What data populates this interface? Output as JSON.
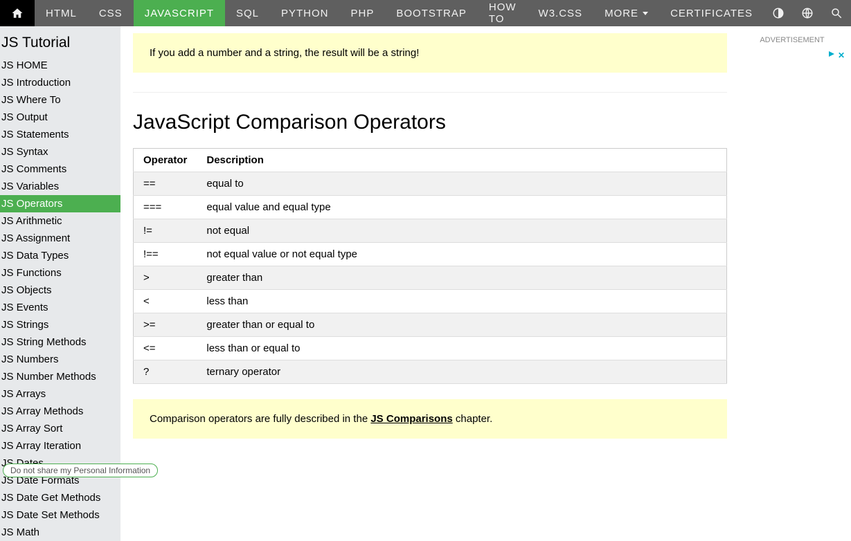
{
  "topnav": {
    "items": [
      {
        "label": "HTML"
      },
      {
        "label": "CSS"
      },
      {
        "label": "JAVASCRIPT",
        "active": true
      },
      {
        "label": "SQL"
      },
      {
        "label": "PYTHON"
      },
      {
        "label": "PHP"
      },
      {
        "label": "BOOTSTRAP"
      },
      {
        "label": "HOW TO"
      },
      {
        "label": "W3.CSS"
      }
    ],
    "more_label": "MORE",
    "certificates_label": "CERTIFICATES"
  },
  "sidebar": {
    "heading": "JS Tutorial",
    "items": [
      {
        "label": "JS HOME"
      },
      {
        "label": "JS Introduction"
      },
      {
        "label": "JS Where To"
      },
      {
        "label": "JS Output"
      },
      {
        "label": "JS Statements"
      },
      {
        "label": "JS Syntax"
      },
      {
        "label": "JS Comments"
      },
      {
        "label": "JS Variables"
      },
      {
        "label": "JS Operators",
        "active": true
      },
      {
        "label": "JS Arithmetic"
      },
      {
        "label": "JS Assignment"
      },
      {
        "label": "JS Data Types"
      },
      {
        "label": "JS Functions"
      },
      {
        "label": "JS Objects"
      },
      {
        "label": "JS Events"
      },
      {
        "label": "JS Strings"
      },
      {
        "label": "JS String Methods"
      },
      {
        "label": "JS Numbers"
      },
      {
        "label": "JS Number Methods"
      },
      {
        "label": "JS Arrays"
      },
      {
        "label": "JS Array Methods"
      },
      {
        "label": "JS Array Sort"
      },
      {
        "label": "JS Array Iteration"
      },
      {
        "label": "JS Dates"
      },
      {
        "label": "JS Date Formats"
      },
      {
        "label": "JS Date Get Methods"
      },
      {
        "label": "JS Date Set Methods"
      },
      {
        "label": "JS Math"
      }
    ]
  },
  "notes": {
    "top": "If you add a number and a string, the result will be a string!",
    "bottom_pre": "Comparison operators are fully described in the ",
    "bottom_link": "JS Comparisons",
    "bottom_post": " chapter."
  },
  "section_title": "JavaScript Comparison Operators",
  "table": {
    "headers": [
      "Operator",
      "Description"
    ],
    "rows": [
      {
        "op": "==",
        "desc": "equal to"
      },
      {
        "op": "===",
        "desc": "equal value and equal type"
      },
      {
        "op": "!=",
        "desc": "not equal"
      },
      {
        "op": "!==",
        "desc": "not equal value or not equal type"
      },
      {
        "op": ">",
        "desc": "greater than"
      },
      {
        "op": "<",
        "desc": "less than"
      },
      {
        "op": ">=",
        "desc": "greater than or equal to"
      },
      {
        "op": "<=",
        "desc": "less than or equal to"
      },
      {
        "op": "?",
        "desc": "ternary operator"
      }
    ]
  },
  "right": {
    "ad_label": "ADVERTISEMENT"
  },
  "cookie_text": "Do not share my Personal Information"
}
